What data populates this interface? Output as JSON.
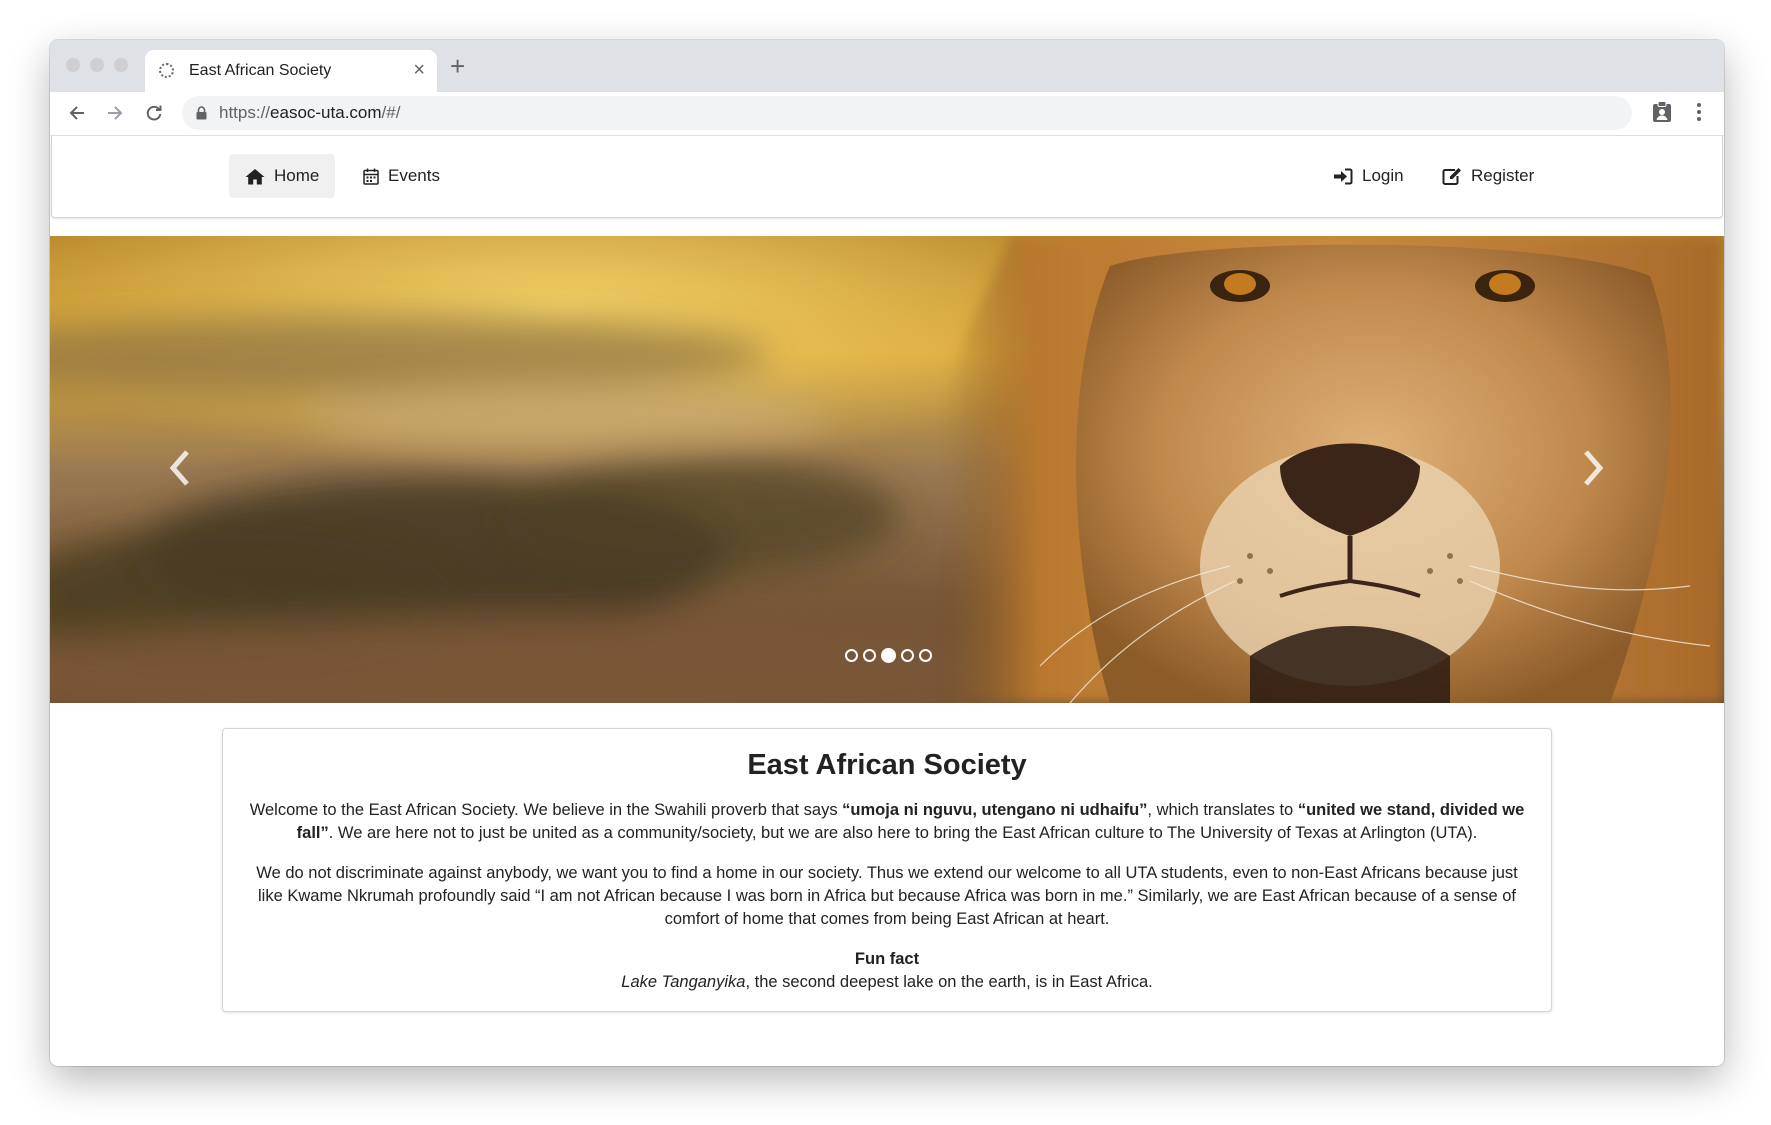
{
  "browser": {
    "tab_title": "East African Society",
    "tab_close": "×",
    "new_tab": "+",
    "url_scheme": "https://",
    "url_host": "easoc-uta.com",
    "url_path": "/#/"
  },
  "navbar": {
    "home_label": "Home",
    "events_label": "Events",
    "login_label": "Login",
    "register_label": "Register"
  },
  "carousel": {
    "slide_count": 5,
    "active_index": 2
  },
  "content": {
    "title": "East African Society",
    "p1_a": "Welcome to the East African Society. We believe in the Swahili proverb that says ",
    "p1_b": "“umoja ni nguvu, utengano ni udhaifu”",
    "p1_c": ", which translates to ",
    "p1_d": "“united we stand, divided we fall”",
    "p1_e": ". We are here not to just be united as a community/society, but we are also here to bring the East African culture to The University of Texas at Arlington (UTA).",
    "p2": "We do not discriminate against anybody, we want you to find a home in our society. Thus we extend our welcome to all UTA students, even to non-East Africans because just like Kwame Nkrumah profoundly said “I am not African because I was born in Africa but because Africa was born in me.” Similarly, we are East African because of a sense of comfort of home that comes from being East African at heart.",
    "fun_fact_heading": "Fun fact",
    "fun_fact_lake": "Lake Tanganyika",
    "fun_fact_rest": ", the second deepest lake on the earth, is in East Africa."
  }
}
